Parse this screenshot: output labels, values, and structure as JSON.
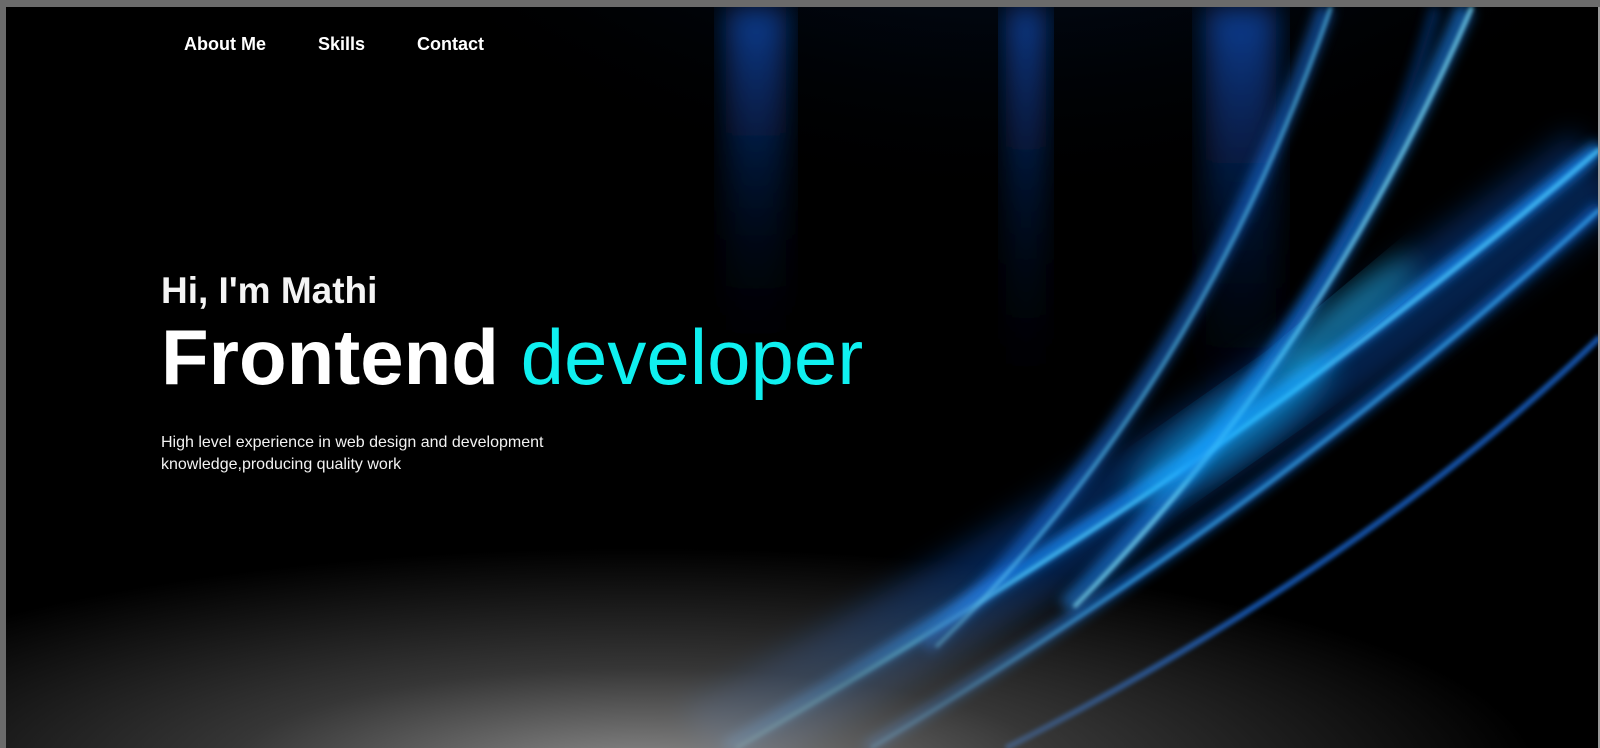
{
  "nav": {
    "items": [
      {
        "label": "About Me"
      },
      {
        "label": "Skills"
      },
      {
        "label": "Contact"
      }
    ]
  },
  "hero": {
    "greeting": "Hi, I'm Mathi",
    "headline_main": "Frontend",
    "headline_accent": "developer",
    "tagline_line1": "High level experience in web design and development",
    "tagline_line2": "knowledge,producing quality work"
  },
  "colors": {
    "background": "#000000",
    "accent": "#0ff0f0",
    "light_streak": "#1e8fff",
    "text": "#ffffff"
  }
}
